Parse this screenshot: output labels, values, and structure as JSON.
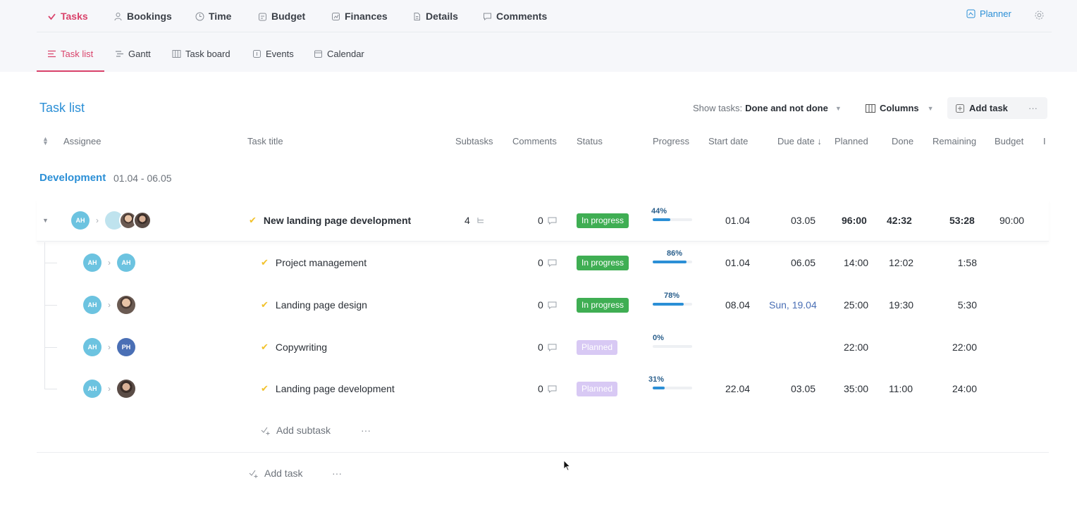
{
  "nav": {
    "items": [
      {
        "label": "Tasks",
        "icon": "check-icon",
        "active": true
      },
      {
        "label": "Bookings",
        "icon": "person-icon"
      },
      {
        "label": "Time",
        "icon": "clock-icon"
      },
      {
        "label": "Budget",
        "icon": "budget-icon"
      },
      {
        "label": "Finances",
        "icon": "finances-icon"
      },
      {
        "label": "Details",
        "icon": "document-icon"
      },
      {
        "label": "Comments",
        "icon": "comment-icon"
      }
    ],
    "planner": "Planner"
  },
  "subnav": {
    "items": [
      {
        "label": "Task list",
        "icon": "list-icon",
        "active": true
      },
      {
        "label": "Gantt",
        "icon": "gantt-icon"
      },
      {
        "label": "Task board",
        "icon": "board-icon"
      },
      {
        "label": "Events",
        "icon": "events-icon"
      },
      {
        "label": "Calendar",
        "icon": "calendar-icon"
      }
    ]
  },
  "toolbar": {
    "title": "Task list",
    "show_tasks_label": "Show tasks:",
    "show_tasks_value": "Done and not done",
    "columns": "Columns",
    "add_task": "Add task",
    "more": "···"
  },
  "columns": {
    "assignee": "Assignee",
    "task_title": "Task title",
    "subtasks": "Subtasks",
    "comments": "Comments",
    "status": "Status",
    "progress": "Progress",
    "start_date": "Start date",
    "due_date": "Due date ↓",
    "planned": "Planned",
    "done": "Done",
    "remaining": "Remaining",
    "budget": "Budget",
    "more": "I"
  },
  "group": {
    "name": "Development",
    "dates": "01.04 - 06.05"
  },
  "parent_task": {
    "assignee_from": "AH",
    "title": "New landing page development",
    "subtasks": "4",
    "comments": "0",
    "status": "In progress",
    "progress_label": "44%",
    "progress": 0.44,
    "start": "01.04",
    "due": "03.05",
    "planned": "96:00",
    "done": "42:32",
    "remaining": "53:28",
    "budget": "90:00"
  },
  "subtasks": [
    {
      "from": "AH",
      "to": "AH",
      "to_type": "ah",
      "title": "Project management",
      "comments": "0",
      "status": "In progress",
      "status_type": "inprogress",
      "progress_label": "86%",
      "progress": 0.86,
      "start": "01.04",
      "due": "06.05",
      "due_highlight": false,
      "planned": "14:00",
      "done": "12:02",
      "remaining": "1:58"
    },
    {
      "from": "AH",
      "to": "",
      "to_type": "photo1",
      "title": "Landing page design",
      "comments": "0",
      "status": "In progress",
      "status_type": "inprogress",
      "progress_label": "78%",
      "progress": 0.78,
      "start": "08.04",
      "due": "Sun, 19.04",
      "due_highlight": true,
      "planned": "25:00",
      "done": "19:30",
      "remaining": "5:30"
    },
    {
      "from": "AH",
      "to": "PH",
      "to_type": "ph",
      "title": "Copywriting",
      "comments": "0",
      "status": "Planned",
      "status_type": "planned",
      "progress_label": "0%",
      "progress": 0,
      "start": "",
      "due": "",
      "due_highlight": false,
      "planned": "22:00",
      "done": "",
      "remaining": "22:00"
    },
    {
      "from": "AH",
      "to": "",
      "to_type": "photo2",
      "title": "Landing page development",
      "comments": "0",
      "status": "Planned",
      "status_type": "planned",
      "progress_label": "31%",
      "progress": 0.31,
      "start": "22.04",
      "due": "03.05",
      "due_highlight": false,
      "planned": "35:00",
      "done": "11:00",
      "remaining": "24:00"
    }
  ],
  "add_subtask": "Add subtask",
  "add_task": "Add task",
  "ellipsis": "···"
}
